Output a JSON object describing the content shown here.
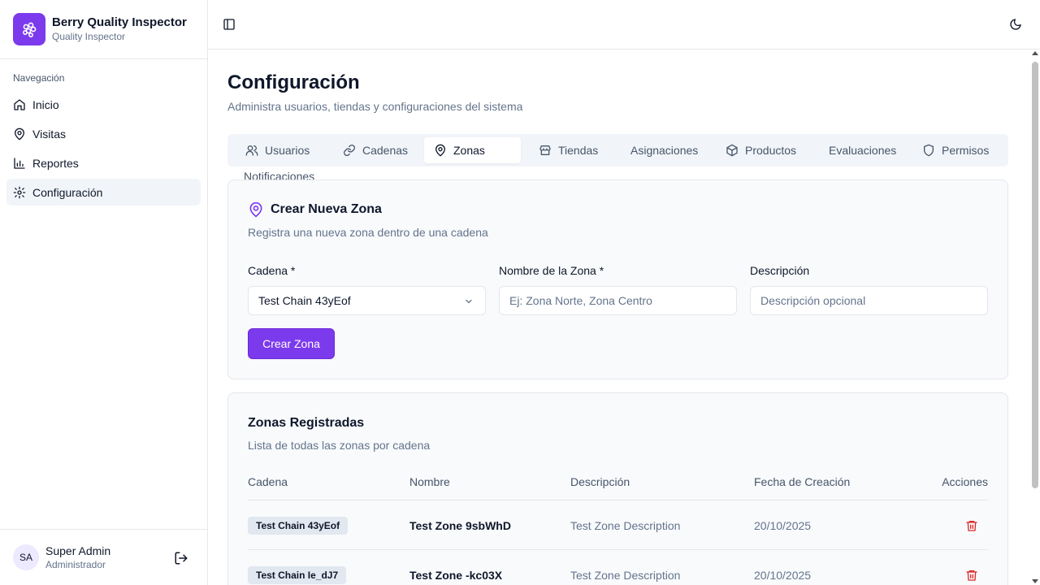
{
  "brand": {
    "title": "Berry Quality Inspector",
    "subtitle": "Quality Inspector",
    "icon": "berry-logo-icon"
  },
  "nav": {
    "label": "Navegación",
    "items": [
      {
        "label": "Inicio",
        "icon": "home-icon"
      },
      {
        "label": "Visitas",
        "icon": "map-pin-icon"
      },
      {
        "label": "Reportes",
        "icon": "bar-chart-icon"
      },
      {
        "label": "Configuración",
        "icon": "gear-icon",
        "active": true
      }
    ]
  },
  "user": {
    "initials": "SA",
    "name": "Super Admin",
    "role": "Administrador"
  },
  "page": {
    "title": "Configuración",
    "subtitle": "Administra usuarios, tiendas y configuraciones del sistema"
  },
  "tabs": [
    {
      "label": "Usuarios",
      "icon": "users-icon"
    },
    {
      "label": "Cadenas",
      "icon": "link-icon"
    },
    {
      "label": "Zonas",
      "icon": "map-pin-icon",
      "active": true
    },
    {
      "label": "Tiendas",
      "icon": "store-icon"
    },
    {
      "label": "Asignaciones"
    },
    {
      "label": "Productos",
      "icon": "package-icon"
    },
    {
      "label": "Evaluaciones"
    },
    {
      "label": "Permisos",
      "icon": "shield-icon"
    },
    {
      "label": "Notificaciones"
    }
  ],
  "create": {
    "title": "Crear Nueva Zona",
    "description": "Registra una nueva zona dentro de una cadena",
    "chain_label": "Cadena *",
    "chain_value": "Test Chain 43yEof",
    "name_label": "Nombre de la Zona *",
    "name_placeholder": "Ej: Zona Norte, Zona Centro",
    "desc_label": "Descripción",
    "desc_placeholder": "Descripción opcional",
    "submit": "Crear Zona"
  },
  "list": {
    "title": "Zonas Registradas",
    "description": "Lista de todas las zonas por cadena",
    "columns": [
      "Cadena",
      "Nombre",
      "Descripción",
      "Fecha de Creación",
      "Acciones"
    ],
    "rows": [
      {
        "chain": "Test Chain 43yEof",
        "name": "Test Zone 9sbWhD",
        "description": "Test Zone Description",
        "date": "20/10/2025"
      },
      {
        "chain": "Test Chain Ie_dJ7",
        "name": "Test Zone -kc03X",
        "description": "Test Zone Description",
        "date": "20/10/2025"
      }
    ]
  },
  "colors": {
    "accent": "#7c3aed",
    "danger": "#dc2626"
  }
}
